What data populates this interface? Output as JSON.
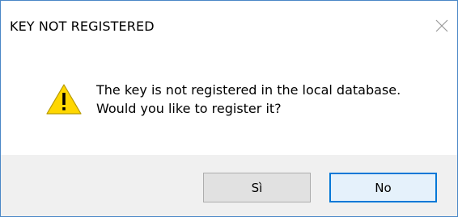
{
  "dialog": {
    "title": "KEY NOT REGISTERED",
    "close_icon": "close-icon",
    "icon": "warning-icon",
    "message_line1": "The key is not registered in the local database.",
    "message_line2": "Would you like to register it?"
  },
  "buttons": {
    "yes_label": "Sì",
    "no_label": "No"
  },
  "colors": {
    "border": "#4a87c7",
    "footer": "#f0f0f0",
    "warning_fill": "#ffd700",
    "focus_border": "#0078d7"
  }
}
